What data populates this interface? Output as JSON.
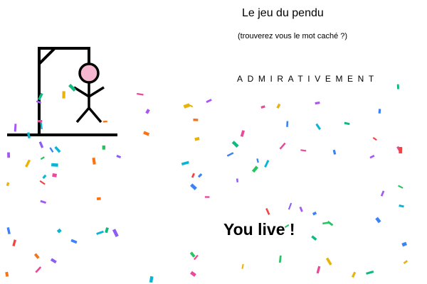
{
  "game": {
    "title": "Le jeu du pendu",
    "subtitle": "(trouverez vous le mot caché ?)",
    "word": "ADMIRATIVEMENT",
    "result": "You live !"
  },
  "colors": {
    "head": "#f5b7cf",
    "stroke": "#000000",
    "confetti": [
      "#a855f7",
      "#22c55e",
      "#f97316",
      "#3b82f6",
      "#ec4899",
      "#06b6d4",
      "#eab308",
      "#ef4444",
      "#10b981",
      "#8b5cf6"
    ]
  }
}
